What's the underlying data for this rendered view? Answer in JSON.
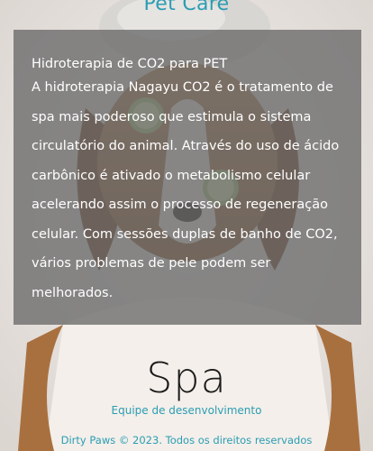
{
  "header": {
    "title": "Pet Care"
  },
  "card": {
    "heading": "Hidroterapia de CO2 para PET",
    "body": "A hidroterapia Nagayu CO2 é o tratamento de spa mais poderoso que estimula o sistema circulatório do animal. Através do uso de ácido carbônico é ativado o metabolismo celular acelerando assim o processo de regeneração celular. Com sessões duplas de banho de CO2, vários problemas de pele podem ser melhorados."
  },
  "section": {
    "title": "Spa",
    "team_link": "Equipe de desenvolvimento"
  },
  "footer": {
    "text": "Dirty Paws © 2023. Todos os direitos reservados"
  },
  "colors": {
    "accent": "#2a9db3",
    "overlay": "rgba(105,105,105,0.78)"
  }
}
